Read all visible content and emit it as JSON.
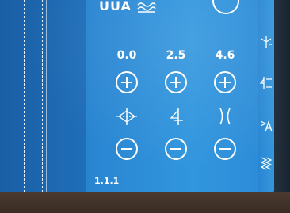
{
  "header": {
    "top_text": "UUA"
  },
  "controls": [
    {
      "value": "0.0",
      "icon": "stitch-position-icon"
    },
    {
      "value": "2.5",
      "icon": "stitch-length-icon"
    },
    {
      "value": "4.6",
      "icon": "stitch-width-icon"
    }
  ],
  "footer": {
    "label": "1.1.1"
  },
  "sidebar_icons": [
    "needle-stop-icon",
    "tie-off-icon",
    "pattern-end-icon",
    "zigzag-icon"
  ],
  "colors": {
    "screen": "#2a86d2",
    "foreground": "#ffffff"
  }
}
